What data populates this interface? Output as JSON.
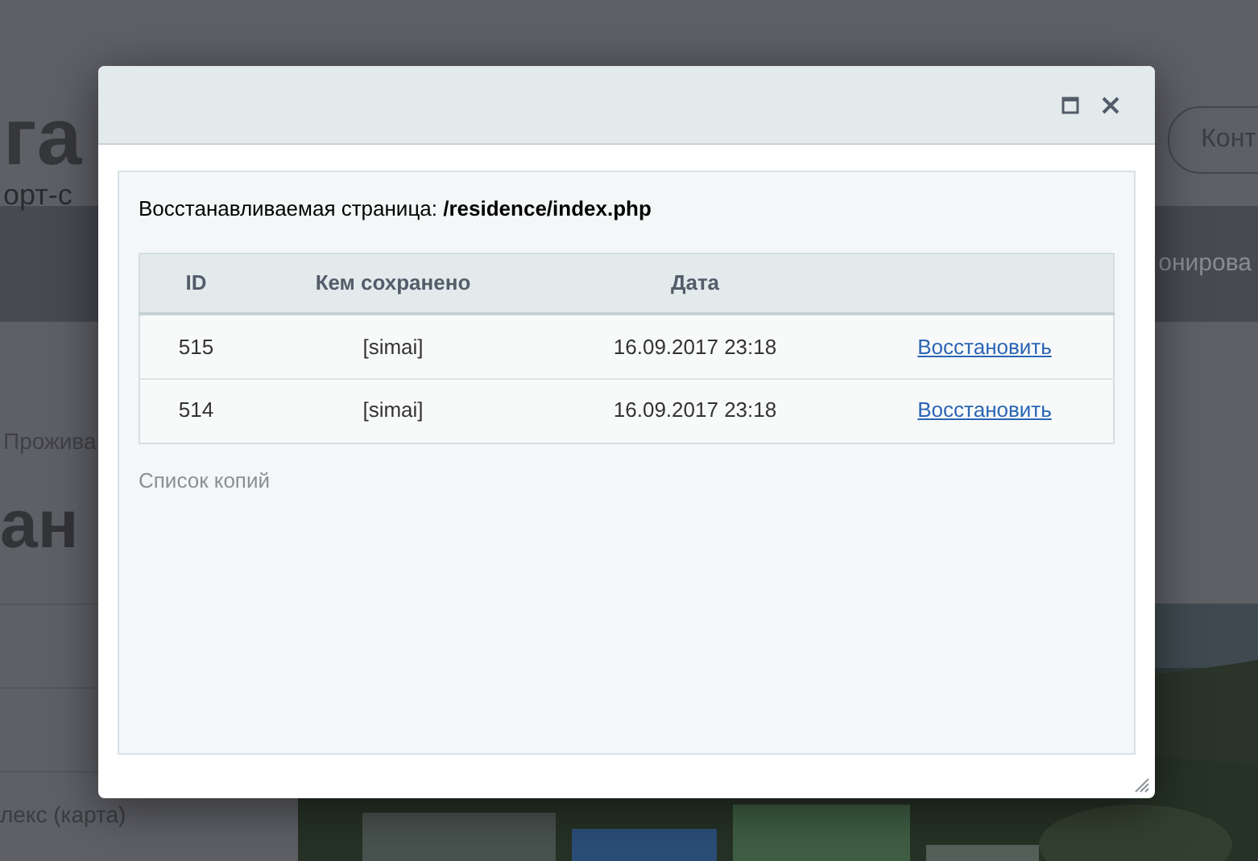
{
  "background_page": {
    "logo_text": "га",
    "logo_subtitle": "орт-с",
    "contact_button": "Конт",
    "nav_item": "онирова",
    "breadcrumb": "Прожива",
    "heading": "ан",
    "sidebar_item": "лекс (карта)"
  },
  "dialog": {
    "page_label": "Восстанавливаемая страница: **/residence/index.php**",
    "table": {
      "columns": [
        "ID",
        "Кем сохранено",
        "Дата"
      ],
      "rows": [
        {
          "id": "515",
          "saved_by": "[simai]",
          "date": "16.09.2017 23:18",
          "action": "Восстановить"
        },
        {
          "id": "514",
          "saved_by": "[simai]",
          "date": "16.09.2017 23:18",
          "action": "Восстановить"
        }
      ]
    },
    "caption": "Список копий"
  }
}
